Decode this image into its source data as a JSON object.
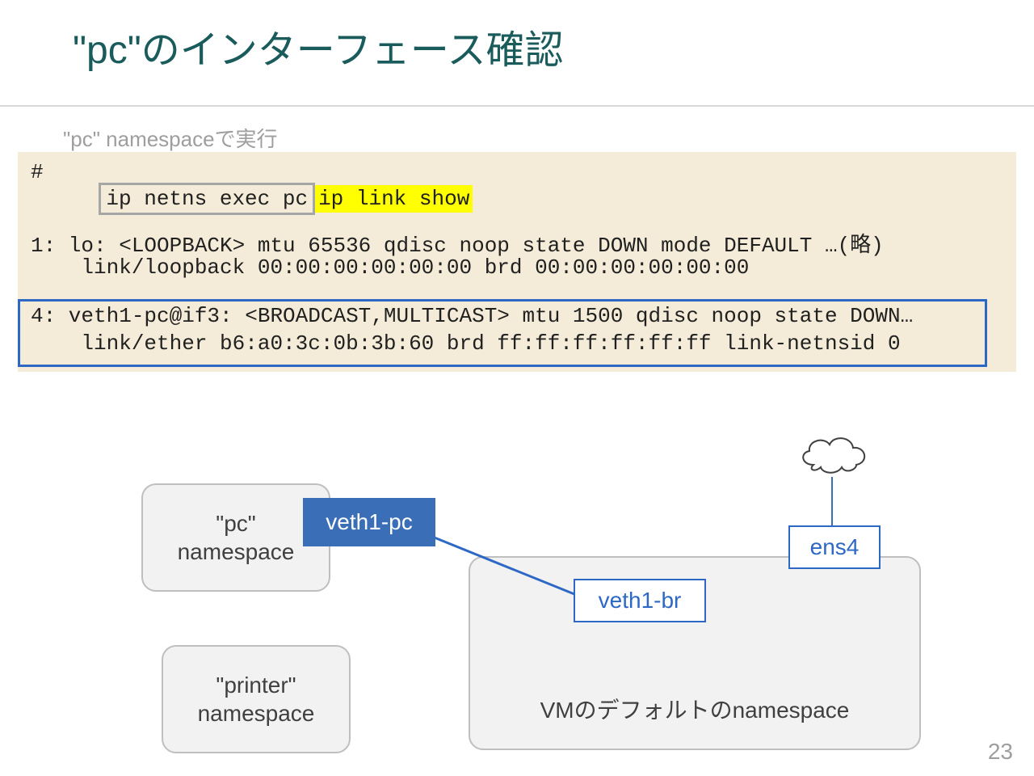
{
  "title": "\"pc\"のインターフェース確認",
  "caption": "\"pc\" namespaceで実行",
  "prompt": "#",
  "command": {
    "boxed": "ip netns exec pc",
    "hl": "ip link show"
  },
  "output": {
    "if1_line1": "1: lo: <LOOPBACK> mtu 65536 qdisc noop state DOWN mode DEFAULT …(略)",
    "if1_line2": "    link/loopback 00:00:00:00:00:00 brd 00:00:00:00:00:00",
    "if4_line1": "4: veth1-pc@if3: <BROADCAST,MULTICAST> mtu 1500 qdisc noop state DOWN…",
    "if4_line2": "    link/ether b6:a0:3c:0b:3b:60 brd ff:ff:ff:ff:ff:ff link-netnsid 0"
  },
  "diagram": {
    "pc_line1": "\"pc\"",
    "pc_line2": "namespace",
    "printer_line1": "\"printer\"",
    "printer_line2": "namespace",
    "vm": "VMのデフォルトのnamespace",
    "veth1pc": "veth1-pc",
    "veth1br": "veth1-br",
    "ens4": "ens4"
  },
  "page_number": "23"
}
